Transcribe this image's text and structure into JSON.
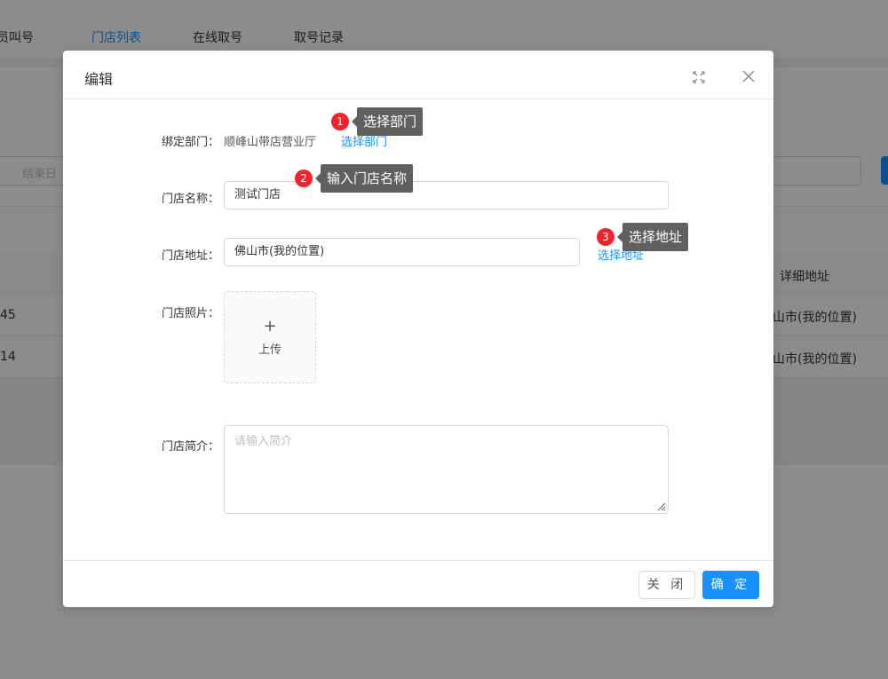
{
  "background": {
    "nav_tabs": [
      {
        "label": "员叫号"
      },
      {
        "label": "门店列表"
      },
      {
        "label": "在线取号"
      },
      {
        "label": "取号记录"
      }
    ],
    "end_date_placeholder": "结束日",
    "table_header_address": "详细地址",
    "rows": [
      {
        "col1": "45",
        "address": "山市(我的位置)"
      },
      {
        "col1": "14",
        "address": "山市(我的位置)"
      }
    ]
  },
  "modal": {
    "title": "编辑",
    "fields": {
      "department_label": "绑定部门：",
      "department_value": "顺峰山带店营业厅",
      "department_link": "选择部门",
      "name_label": "门店名称：",
      "name_value": "测试门店",
      "address_label": "门店地址：",
      "address_value": "佛山市(我的位置)",
      "address_link": "选择地址",
      "photo_label": "门店照片：",
      "upload_plus": "+",
      "upload_text": "上传",
      "intro_label": "门店简介：",
      "intro_placeholder": "请输入简介"
    },
    "footer": {
      "close_label": "关 闭",
      "confirm_label": "确 定"
    }
  },
  "tips": [
    {
      "num": "1",
      "text": "选择部门"
    },
    {
      "num": "2",
      "text": "输入门店名称"
    },
    {
      "num": "3",
      "text": "选择地址"
    }
  ],
  "colors": {
    "primary": "#1890ff",
    "tip_badge": "#f5222d",
    "tip_bg": "#606060",
    "mask": "rgba(0,0,0,0.45)"
  },
  "icons": [
    "fullscreen-icon",
    "close-icon",
    "plus-icon",
    "resize-grip-icon"
  ]
}
